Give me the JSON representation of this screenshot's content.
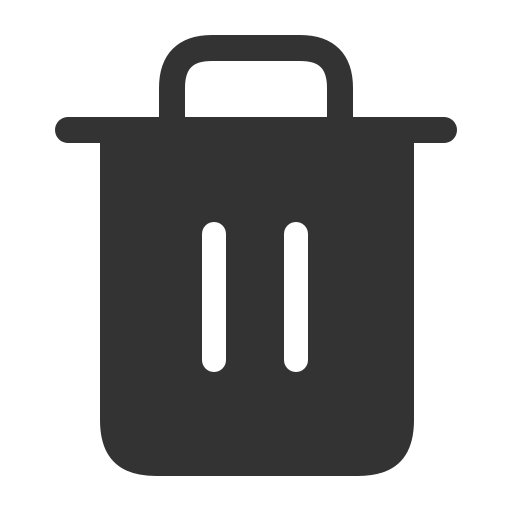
{
  "icon": {
    "name": "trash-icon",
    "colors": {
      "background": "#ffffff",
      "foreground": "#333333",
      "slot": "#ffffff"
    }
  }
}
